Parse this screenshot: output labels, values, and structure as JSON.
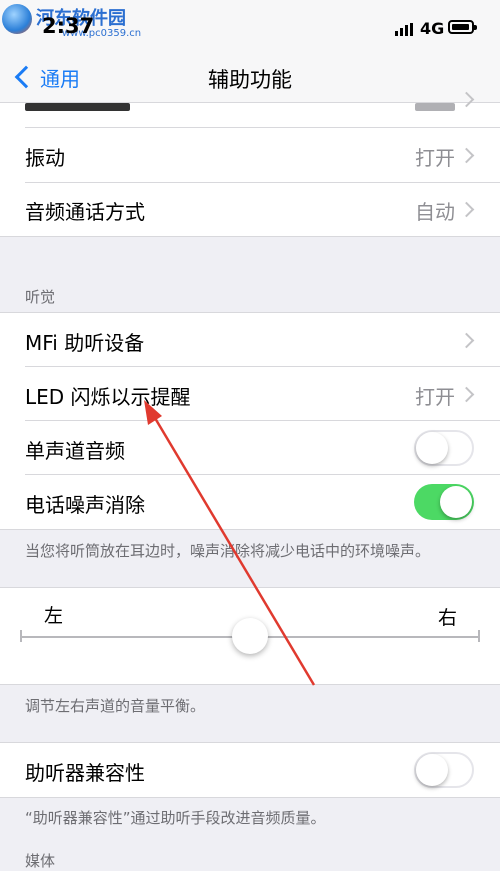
{
  "status": {
    "time": "2:37",
    "network": "4G",
    "watermark_title": "河东软件园",
    "watermark_url": "www.pc0359.cn"
  },
  "nav": {
    "back_label": "通用",
    "title": "辅助功能"
  },
  "rows_top": [
    {
      "label": "振动",
      "value": "打开"
    },
    {
      "label": "音频通话方式",
      "value": "自动"
    }
  ],
  "hearing": {
    "header": "听觉",
    "rows": [
      {
        "label": "MFi 助听设备",
        "value": ""
      },
      {
        "label": "LED 闪烁以示提醒",
        "value": "打开"
      },
      {
        "label": "单声道音频",
        "toggle": false
      },
      {
        "label": "电话噪声消除",
        "toggle": true
      }
    ],
    "footer": "当您将听筒放在耳边时，噪声消除将减少电话中的环境噪声。"
  },
  "balance": {
    "left_label": "左",
    "right_label": "右",
    "value": 0.5,
    "footer": "调节左右声道的音量平衡。"
  },
  "hearing_aid": {
    "label": "助听器兼容性",
    "toggle": false,
    "footer": "“助听器兼容性”通过助听手段改进音频质量。"
  },
  "media_header": "媒体",
  "colors": {
    "accent": "#1a7cf5",
    "toggle_on": "#4cd964",
    "annotation_arrow": "#e03a2f"
  }
}
